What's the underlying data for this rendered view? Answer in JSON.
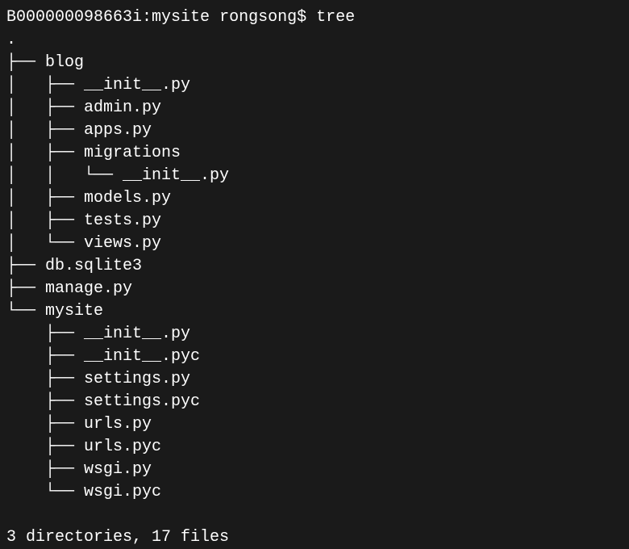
{
  "prompt": {
    "host": "B000000098663i",
    "cwd": "mysite",
    "user": "rongsong",
    "symbol": "$",
    "command": "tree"
  },
  "root": ".",
  "lines": [
    "├── blog",
    "│   ├── __init__.py",
    "│   ├── admin.py",
    "│   ├── apps.py",
    "│   ├── migrations",
    "│   │   └── __init__.py",
    "│   ├── models.py",
    "│   ├── tests.py",
    "│   └── views.py",
    "├── db.sqlite3",
    "├── manage.py",
    "└── mysite",
    "    ├── __init__.py",
    "    ├── __init__.pyc",
    "    ├── settings.py",
    "    ├── settings.pyc",
    "    ├── urls.py",
    "    ├── urls.pyc",
    "    ├── wsgi.py",
    "    └── wsgi.pyc"
  ],
  "summary": "3 directories, 17 files"
}
